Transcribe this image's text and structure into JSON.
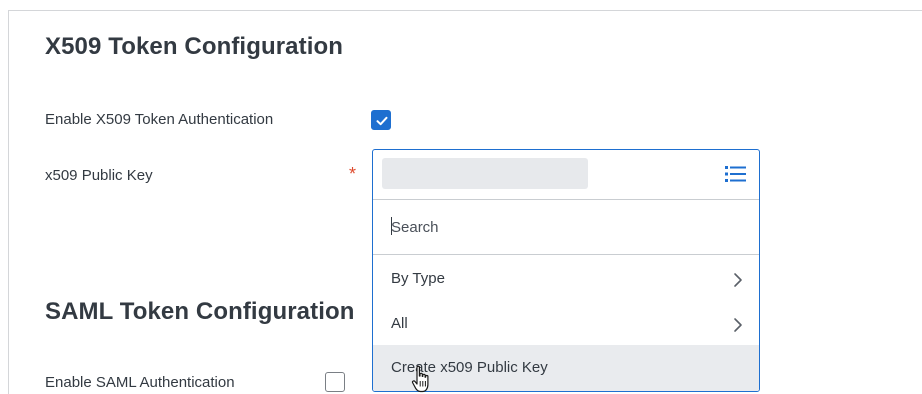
{
  "x509_section": {
    "title": "X509 Token Configuration",
    "enable_label": "Enable X509 Token Authentication",
    "enable_checked": true,
    "public_key_label": "x509 Public Key",
    "required_marker": "*"
  },
  "prompt_dropdown": {
    "search_placeholder": "Search",
    "items": [
      {
        "label": "By Type",
        "has_submenu": true
      },
      {
        "label": "All",
        "has_submenu": true
      },
      {
        "label": "Create x509 Public Key",
        "has_submenu": false
      }
    ]
  },
  "saml_section": {
    "title": "SAML Token Configuration",
    "enable_label": "Enable SAML Authentication",
    "enable_checked": false
  },
  "colors": {
    "accent": "#1e6fd0",
    "required": "#de4b2e",
    "text": "#333a42",
    "hover_row": "#e9ebee"
  },
  "icons": {
    "prompt": "list-icon",
    "submenu": "chevron-right-icon",
    "cursor": "hand-pointer-icon",
    "check": "checkmark-icon"
  }
}
